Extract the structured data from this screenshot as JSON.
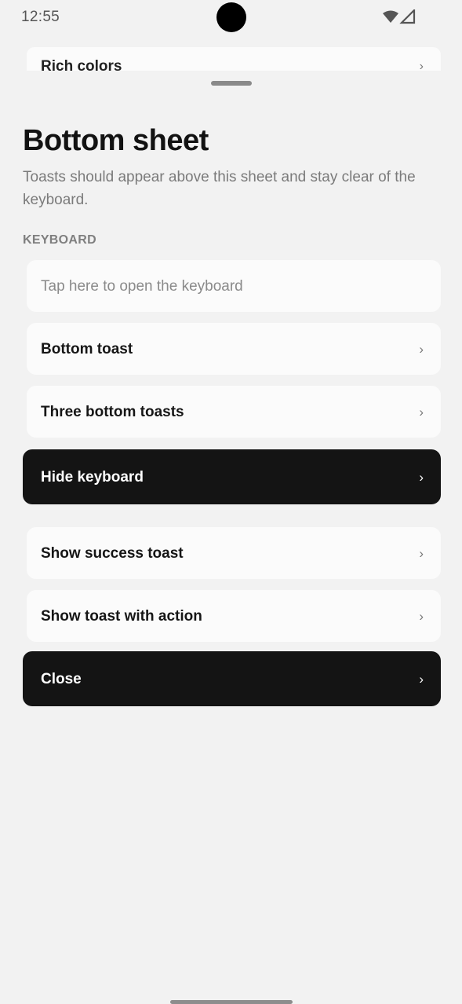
{
  "status_bar": {
    "time": "12:55",
    "icons": [
      "wifi-icon",
      "cellular-signal-icon"
    ]
  },
  "underlying": {
    "label": "Rich colors",
    "chevron": "›"
  },
  "sheet": {
    "title": "Bottom sheet",
    "description": "Toasts should appear above this sheet and stay clear of the keyboard.",
    "section_label": "KEYBOARD",
    "input": {
      "placeholder": "Tap here to open the keyboard",
      "value": ""
    },
    "rows": [
      {
        "label": "Bottom toast",
        "chevron": "›"
      },
      {
        "label": "Three bottom toasts",
        "chevron": "›"
      },
      {
        "label": "Hide keyboard",
        "chevron": "›"
      },
      {
        "label": "Show success toast",
        "chevron": "›"
      },
      {
        "label": "Show toast with action",
        "chevron": "›"
      },
      {
        "label": "Close",
        "chevron": "›"
      }
    ]
  },
  "colors": {
    "background": "#f2f2f2",
    "row_background": "#fbfbfb",
    "dark_button": "#141414",
    "text_primary": "#161616",
    "text_secondary": "#7b7b7b"
  }
}
